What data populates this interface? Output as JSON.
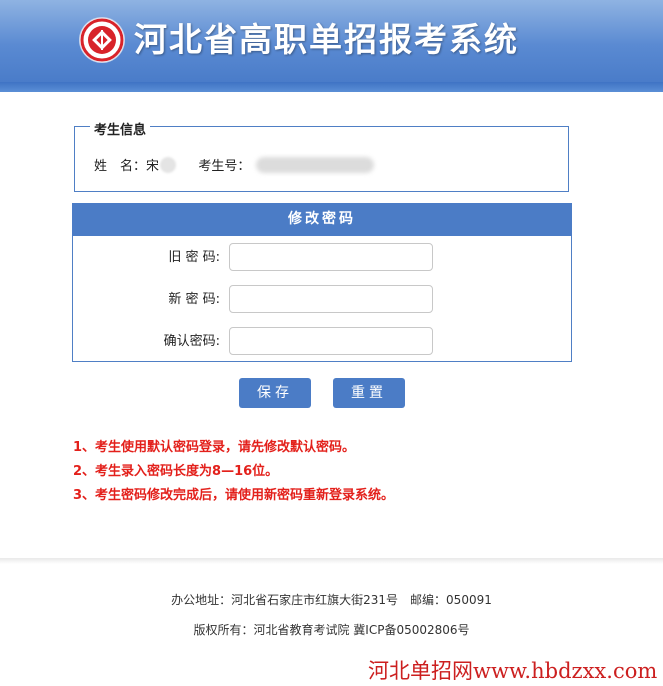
{
  "header": {
    "title": "河北省高职单招报考系统",
    "logo_icon": "exam-institute-seal-icon",
    "colors": {
      "bar": "#4b7cc6",
      "logo_red": "#d8232a"
    }
  },
  "student_info": {
    "legend": "考生信息",
    "name_label": "姓　名：",
    "name_value": "宋",
    "exam_no_label": "考生号："
  },
  "password_form": {
    "title": "修改密码",
    "old_label": "旧 密 码:",
    "new_label": "新 密 码:",
    "confirm_label": "确认密码:",
    "old_value": "",
    "new_value": "",
    "confirm_value": ""
  },
  "buttons": {
    "save": "保存",
    "reset": "重置"
  },
  "notes": [
    "1、考生使用默认密码登录，请先修改默认密码。",
    "2、考生录入密码长度为8—16位。",
    "3、考生密码修改完成后，请使用新密码重新登录系统。"
  ],
  "footer": {
    "address": "办公地址：河北省石家庄市红旗大街231号　邮编：050091",
    "copyright": "版权所有：河北省教育考试院 冀ICP备05002806号"
  },
  "watermark": "河北单招网www.hbdzxx.com"
}
